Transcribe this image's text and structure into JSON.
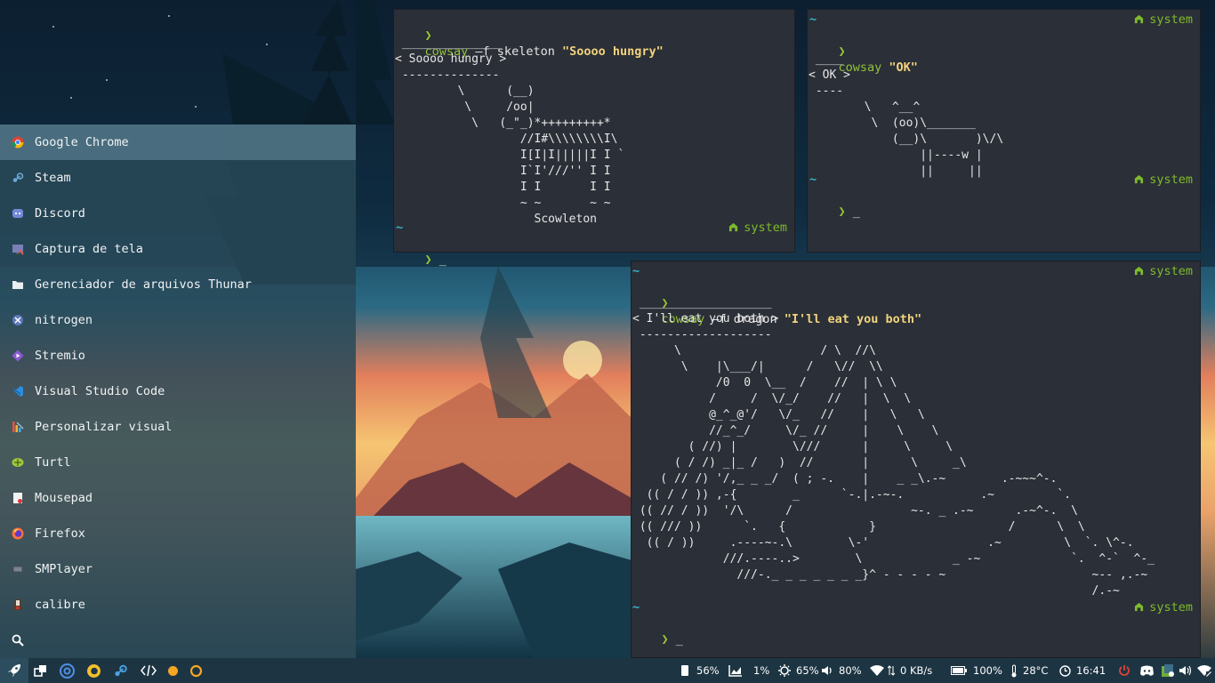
{
  "terminals": {
    "skeleton": {
      "command_name": "cowsay",
      "command_args": " –f skeleton ",
      "command_quote": "\"Soooo hungry\"",
      "output": " ______________\n< Soooo hungry >\n --------------\n         \\      (__)\n          \\     /oo|\n           \\   (_\"_)*+++++++++*\n                  //I#\\\\\\\\\\\\\\\\I\\\n                  I[I|I|||||I I `\n                  I`I'///'' I I\n                  I I       I I\n                  ~ ~       ~ ~\n                    Scowleton",
      "tilde": "~",
      "prompt_symbol": "❯",
      "cursor": "_",
      "system_label": "system"
    },
    "ok": {
      "tilde_top": "~",
      "system_label_top": "system",
      "command_name": "cowsay",
      "command_quote": " \"OK\"",
      "output": " ____\n< OK >\n ----\n        \\   ^__^\n         \\  (oo)\\_______\n            (__)\\       )\\/\\\n                ||----w |\n                ||     ||",
      "tilde": "~",
      "prompt_symbol": "❯",
      "cursor": "_",
      "system_label": "system"
    },
    "dragon": {
      "tilde_top": "~",
      "system_label_top": "system",
      "command_name": "cowsay",
      "command_args": " –f dragon ",
      "command_quote": "\"I'll eat you both\"",
      "output": " ___________________\n< I'll eat you both >\n -------------------\n      \\                    / \\  //\\\n       \\    |\\___/|      /   \\//  \\\\\n            /0  0  \\__  /    //  | \\ \\\n           /     /  \\/_/    //   |  \\  \\\n           @_^_@'/   \\/_   //    |   \\   \\\n           //_^_/     \\/_ //     |    \\    \\\n        ( //) |        \\///      |     \\     \\\n      ( / /) _|_ /   )  //       |      \\     _\\\n    ( // /) '/,_ _ _/  ( ; -.    |    _ _\\.-~        .-~~~^-.\n  (( / / )) ,-{        _      `-.|.-~-.           .~         `.\n (( // / ))  '/\\      /                 ~-. _ .-~      .-~^-.  \\\n (( /// ))      `.   {            }                   /      \\  \\\n  (( / ))     .----~-.\\        \\-'                 .~         \\  `. \\^-.\n             ///.----..>        \\             _ -~             `.  ^-`  ^-_\n               ///-._ _ _ _ _ _ _}^ - - - - ~                     ~-- ,.-~\n                                                                  /.-~",
      "tilde": "~",
      "prompt_symbol": "❯",
      "cursor": "_",
      "system_label": "system"
    }
  },
  "menu": {
    "items": [
      {
        "label": "Google Chrome",
        "icon": "chrome-icon"
      },
      {
        "label": "Steam",
        "icon": "steam-icon"
      },
      {
        "label": "Discord",
        "icon": "discord-icon"
      },
      {
        "label": "Captura de tela",
        "icon": "screenshot-icon"
      },
      {
        "label": "Gerenciador de arquivos Thunar",
        "icon": "folder-icon"
      },
      {
        "label": "nitrogen",
        "icon": "nitrogen-icon"
      },
      {
        "label": "Stremio",
        "icon": "stremio-icon"
      },
      {
        "label": "Visual Studio Code",
        "icon": "vscode-icon"
      },
      {
        "label": "Personalizar visual",
        "icon": "appearance-icon"
      },
      {
        "label": "Turtl",
        "icon": "turtl-icon"
      },
      {
        "label": "Mousepad",
        "icon": "mousepad-icon"
      },
      {
        "label": "Firefox",
        "icon": "firefox-icon"
      },
      {
        "label": "SMPlayer",
        "icon": "smplayer-icon"
      },
      {
        "label": "calibre",
        "icon": "calibre-icon"
      }
    ],
    "search_icon": "search-icon"
  },
  "taskbar": {
    "memory": "56%",
    "cpu": "1%",
    "brightness": "65%",
    "volume": "80%",
    "network": "0 KB/s",
    "battery": "100%",
    "temperature": "28°C",
    "clock": "16:41"
  },
  "colors": {
    "terminal_bg": "#2b2f37",
    "menu_bg": "#294959",
    "taskbar_bg": "#1d3543",
    "prompt_green": "#98c935",
    "tilde_cyan": "#34b6cf",
    "quote_yellow": "#f1d37d"
  }
}
